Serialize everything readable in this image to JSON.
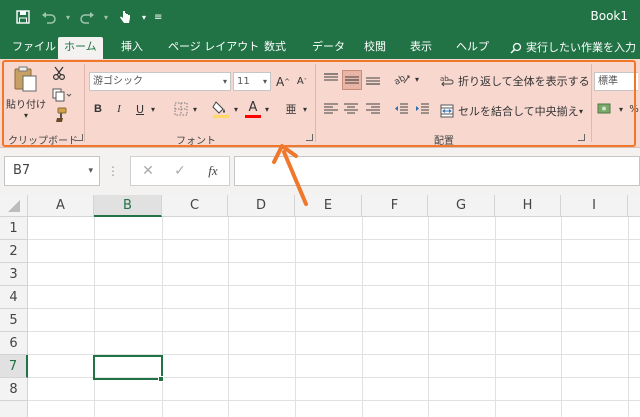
{
  "app": {
    "document_title": "Book1"
  },
  "colors": {
    "excel_green": "#217346",
    "ribbon_highlight_fill": "#f8d7cf",
    "ribbon_highlight_border": "#f0782c",
    "font_color_red": "#ff0000",
    "fill_yellow": "#ffd966"
  },
  "qat": [
    "save-icon",
    "undo-icon",
    "redo-icon",
    "touch-mode-icon",
    "customize-qat-icon"
  ],
  "tabs": [
    {
      "label": "ファイル"
    },
    {
      "label": "ホーム"
    },
    {
      "label": "挿入"
    },
    {
      "label": "ページ レイアウト"
    },
    {
      "label": "数式"
    },
    {
      "label": "データ"
    },
    {
      "label": "校閲"
    },
    {
      "label": "表示"
    },
    {
      "label": "ヘルプ"
    }
  ],
  "tell_me": "実行したい作業を入力",
  "ribbon": {
    "clipboard": {
      "paste": "貼り付け",
      "group_label": "クリップボード"
    },
    "font": {
      "font_name": "游ゴシック",
      "font_size": "11",
      "group_label": "フォント",
      "bold": "B",
      "italic": "I",
      "underline": "U",
      "font_color_letter": "A",
      "grow": "A",
      "shrink": "A",
      "phonetic": "亜"
    },
    "alignment": {
      "wrap_text": "折り返して全体を表示する",
      "merge_center": "セルを結合して中央揃え",
      "group_label": "配置"
    },
    "number": {
      "format": "標準"
    }
  },
  "formula_bar": {
    "name_box": "B7",
    "fx": "fx",
    "cancel": "✕",
    "enter": "✓"
  },
  "grid": {
    "columns": [
      "A",
      "B",
      "C",
      "D",
      "E",
      "F",
      "G",
      "H",
      "I"
    ],
    "rows": [
      "1",
      "2",
      "3",
      "4",
      "5",
      "6",
      "7",
      "8"
    ],
    "selected_column": "B",
    "selected_row": "7"
  }
}
